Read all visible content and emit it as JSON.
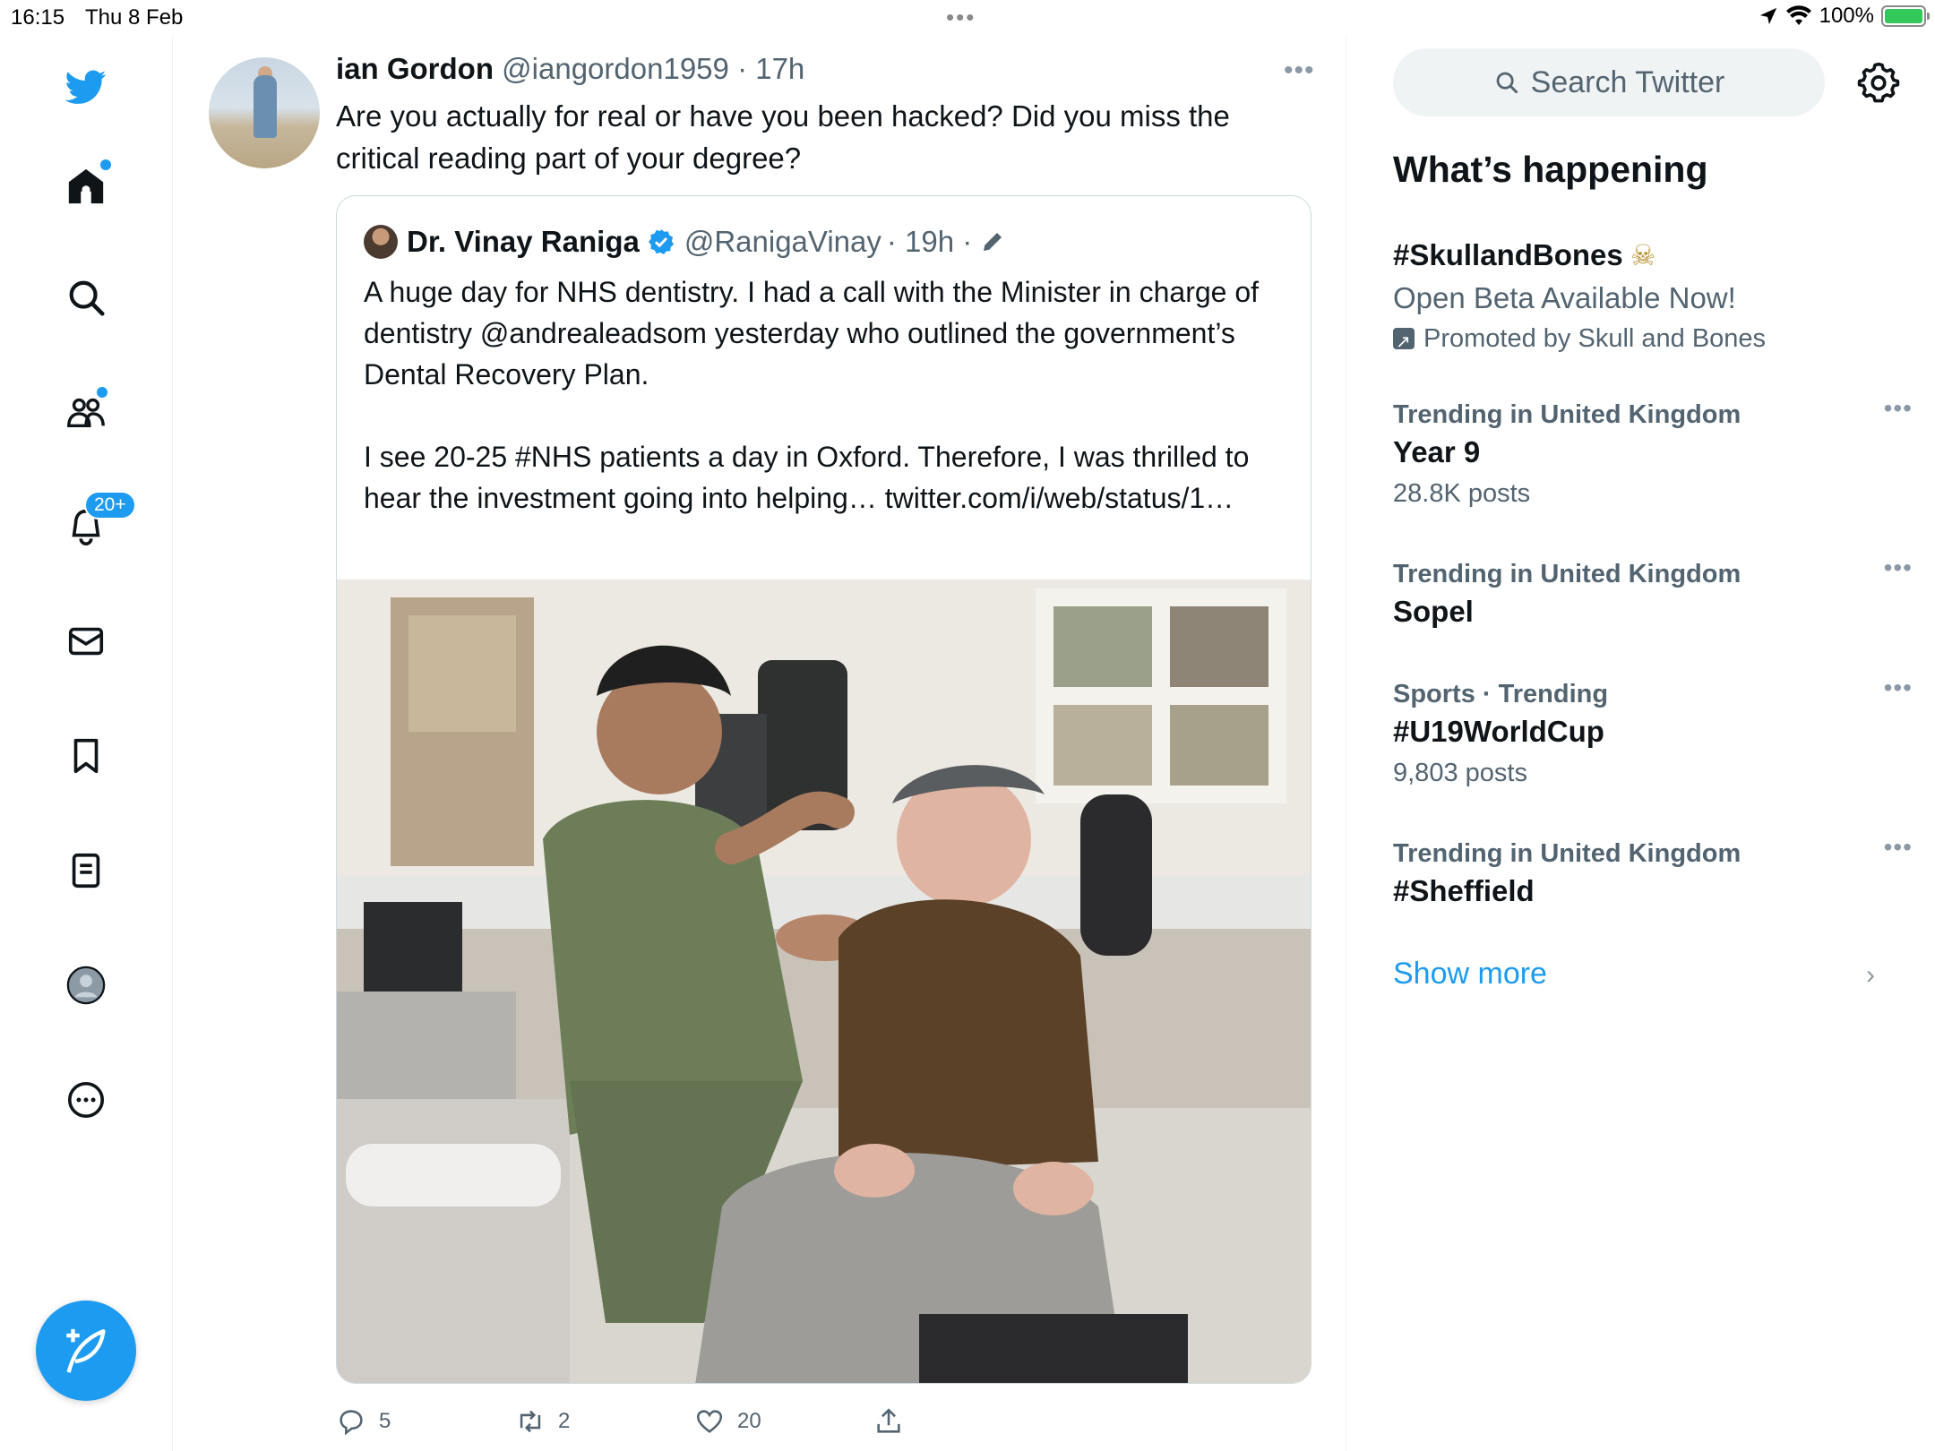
{
  "status_bar": {
    "time": "16:15",
    "date": "Thu 8 Feb",
    "battery": "100%"
  },
  "nav": {
    "notifications_badge": "20+",
    "items": [
      "twitter-logo",
      "home-icon",
      "search-icon",
      "communities-icon",
      "notifications-icon",
      "messages-icon",
      "bookmarks-icon",
      "lists-icon",
      "profile-icon",
      "more-icon"
    ]
  },
  "tweet": {
    "author_name": "ian Gordon",
    "author_handle": "@iangordon1959",
    "time": "· 17h",
    "text": "Are you actually for real or have you been hacked? Did you miss the critical reading part of your degree?",
    "replies": "5",
    "retweets": "2",
    "likes": "20"
  },
  "quote": {
    "author_name": "Dr. Vinay Raniga",
    "author_handle": "@RanigaVinay",
    "time": "· 19h ·",
    "paragraph1": "A huge day for NHS dentistry. I had a call with the Minister in charge of dentistry @andrealeadsom yesterday who outlined the government’s Dental Recovery Plan.",
    "paragraph2": "I see 20-25 #NHS patients a day in Oxford. Therefore, I was thrilled to hear the investment going into helping… twitter.com/i/web/status/1…"
  },
  "sidebar": {
    "search_placeholder": "Search Twitter",
    "whats_happening": "What’s happening",
    "promo": {
      "title": "#SkullandBones",
      "subtitle": "Open Beta Available Now!",
      "promoted_by": "Promoted by Skull and Bones"
    },
    "trends": [
      {
        "context": "Trending in United Kingdom",
        "title": "Year 9",
        "posts": "28.8K posts"
      },
      {
        "context": "Trending in United Kingdom",
        "title": "Sopel",
        "posts": ""
      },
      {
        "context": "Sports · Trending",
        "title": "#U19WorldCup",
        "posts": "9,803 posts"
      },
      {
        "context": "Trending in United Kingdom",
        "title": "#Sheffield",
        "posts": ""
      }
    ],
    "show_more": "Show more"
  },
  "colors": {
    "accent": "#1d9bf0",
    "secondary_text": "#536471",
    "border": "#cfd9de"
  }
}
